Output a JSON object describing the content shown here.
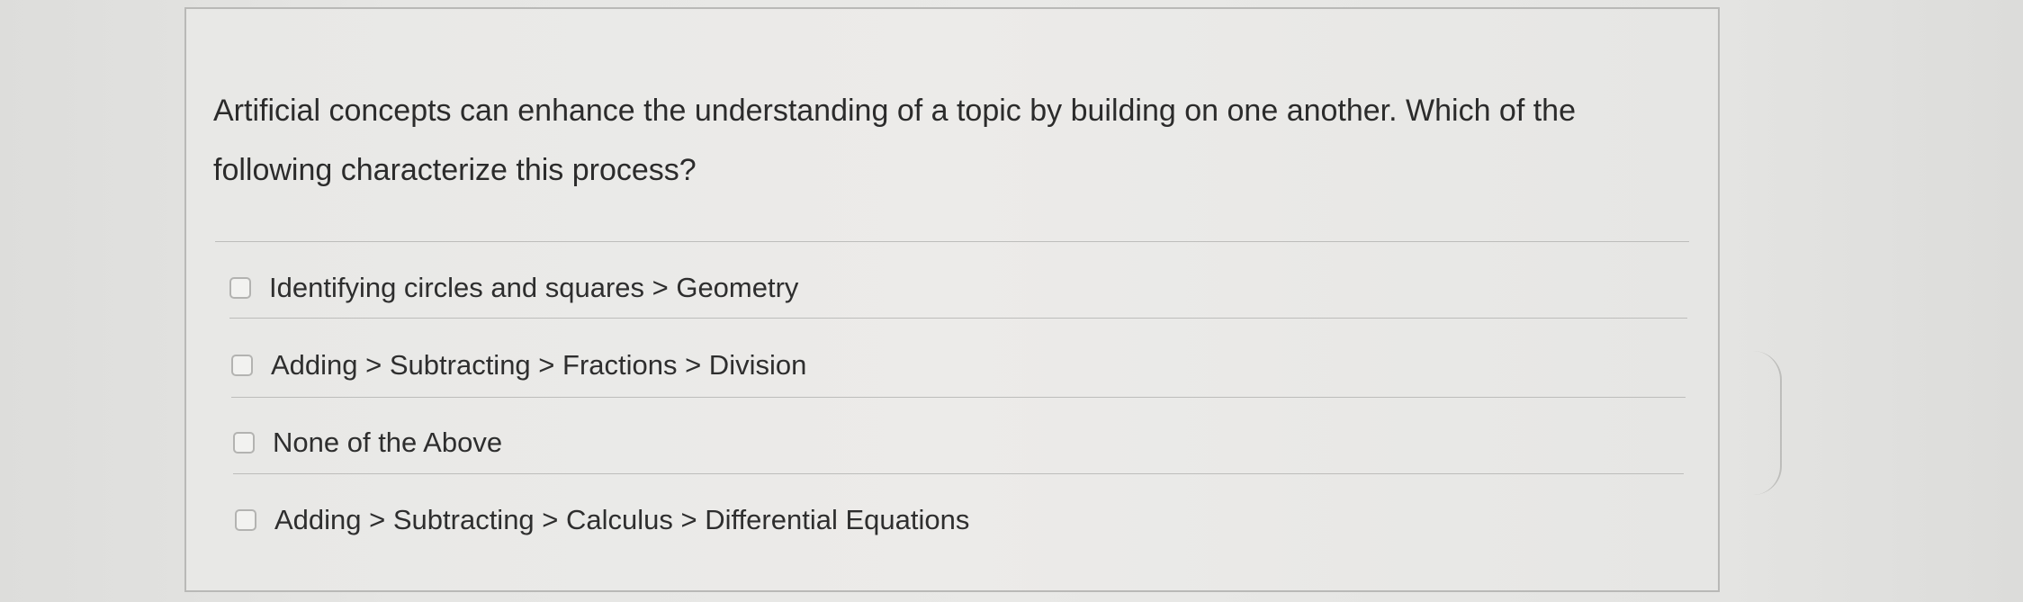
{
  "question": {
    "text": "Artificial concepts can enhance the understanding of a topic by building on one another. Which of the following characterize this process?"
  },
  "options": [
    {
      "label": "Identifying circles and squares > Geometry",
      "checked": false
    },
    {
      "label": "Adding > Subtracting > Fractions > Division",
      "checked": false
    },
    {
      "label": "None of the Above",
      "checked": false
    },
    {
      "label": "Adding > Subtracting > Calculus > Differential Equations",
      "checked": false
    }
  ]
}
